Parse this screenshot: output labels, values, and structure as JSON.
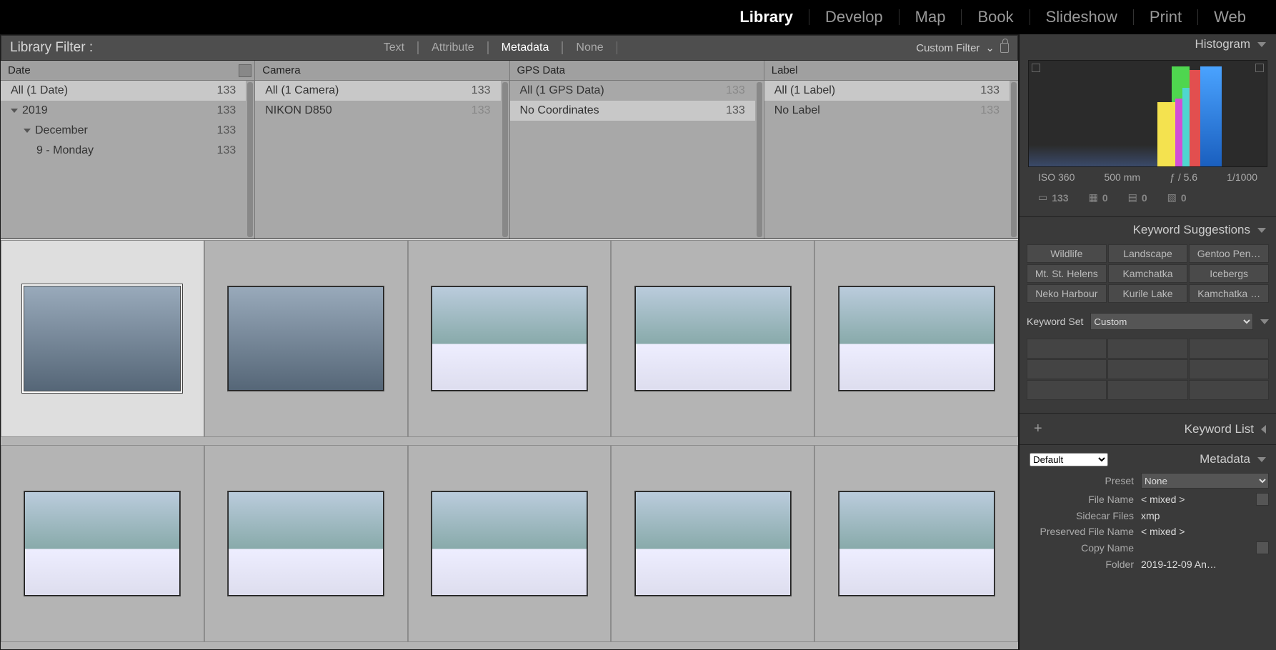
{
  "modules": [
    "Library",
    "Develop",
    "Map",
    "Book",
    "Slideshow",
    "Print",
    "Web"
  ],
  "active_module": "Library",
  "filter_bar": {
    "title": "Library Filter :",
    "tabs": [
      "Text",
      "Attribute",
      "Metadata",
      "None"
    ],
    "active": "Metadata",
    "custom": "Custom Filter"
  },
  "meta_columns": [
    {
      "title": "Date",
      "rows": [
        {
          "label": "All (1 Date)",
          "count": "133",
          "sel": true
        },
        {
          "label": "2019",
          "count": "133",
          "tri": true
        },
        {
          "label": "December",
          "count": "133",
          "tri": true,
          "indent": 1
        },
        {
          "label": "9 - Monday",
          "count": "133",
          "indent": 2
        }
      ]
    },
    {
      "title": "Camera",
      "rows": [
        {
          "label": "All (1 Camera)",
          "count": "133",
          "sel": true
        },
        {
          "label": "NIKON D850",
          "count": "133",
          "dim": true
        }
      ]
    },
    {
      "title": "GPS Data",
      "rows": [
        {
          "label": "All (1 GPS Data)",
          "count": "133",
          "dim": true
        },
        {
          "label": "No Coordinates",
          "count": "133",
          "sel": true
        }
      ]
    },
    {
      "title": "Label",
      "rows": [
        {
          "label": "All (1 Label)",
          "count": "133",
          "sel": true
        },
        {
          "label": "No Label",
          "count": "133",
          "dim": true
        }
      ]
    }
  ],
  "histogram": {
    "title": "Histogram",
    "info": [
      "ISO 360",
      "500 mm",
      "ƒ / 5.6",
      "1/1000"
    ],
    "counts": [
      "133",
      "0",
      "0",
      "0"
    ]
  },
  "kw_sugg": {
    "title": "Keyword Suggestions",
    "cells": [
      "Wildlife",
      "Landscape",
      "Gentoo Pen…",
      "Mt. St. Helens",
      "Kamchatka",
      "Icebergs",
      "Neko Harbour",
      "Kurile Lake",
      "Kamchatka …"
    ]
  },
  "kw_set": {
    "label": "Keyword Set",
    "value": "Custom"
  },
  "kw_list_title": "Keyword List",
  "meta_panel": {
    "title": "Metadata",
    "default": "Default",
    "preset_label": "Preset",
    "preset_value": "None",
    "rows": [
      {
        "l": "File Name",
        "v": "< mixed >",
        "btn": true
      },
      {
        "l": "Sidecar Files",
        "v": "xmp"
      },
      {
        "l": "Preserved File Name",
        "v": "< mixed >"
      },
      {
        "l": "Copy Name",
        "v": "",
        "btn": true
      },
      {
        "l": "Folder",
        "v": "2019-12-09 An…"
      }
    ]
  },
  "grid_selected_index": 0
}
